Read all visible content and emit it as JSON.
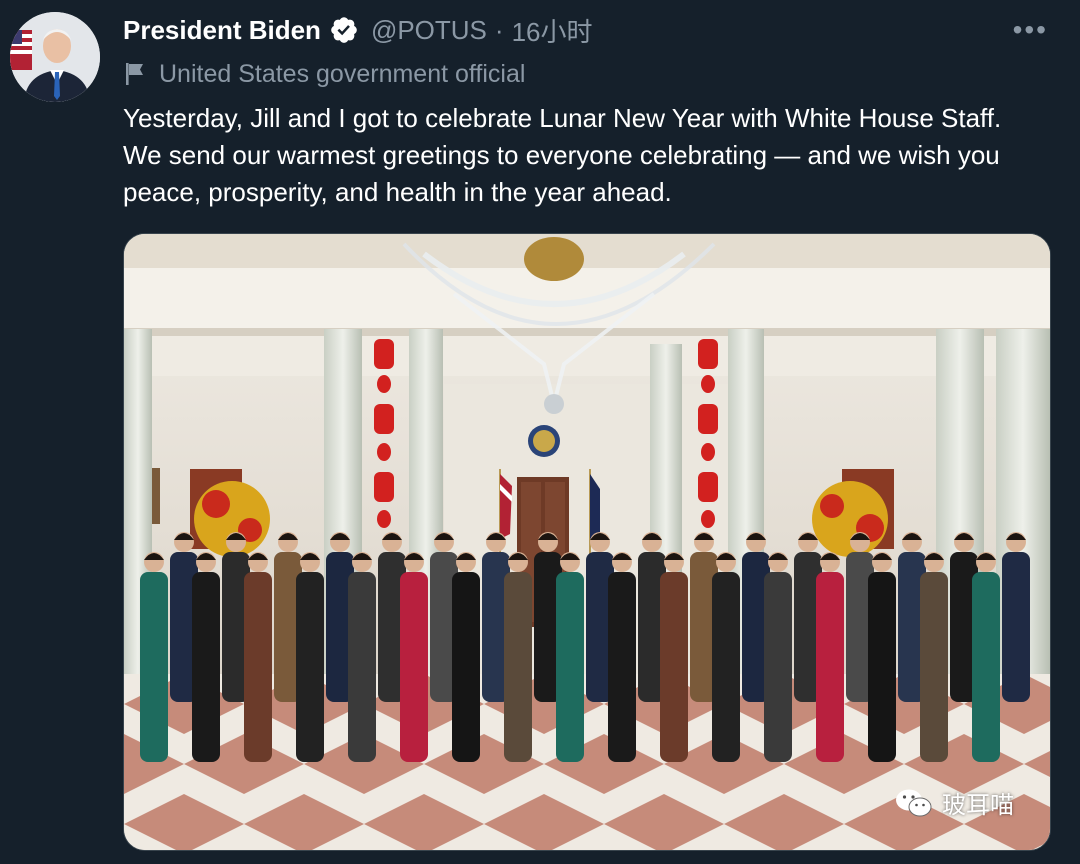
{
  "tweet": {
    "author_name": "President Biden",
    "handle": "@POTUS",
    "separator": "·",
    "time": "16小时",
    "account_label": "United States government official",
    "text": "Yesterday, Jill and I got to celebrate Lunar New Year with White House Staff. We send our warmest greetings to everyone celebrating — and we wish you peace, prosperity, and health in the year ahead.",
    "more_label": "•••"
  },
  "watermark": {
    "text": "玻耳喵"
  },
  "icons": {
    "verified": "verified-badge-icon",
    "label": "flag-icon",
    "more": "more-options-icon",
    "watermark": "wechat-icon"
  },
  "colors": {
    "background": "#15202b",
    "text_primary": "#ffffff",
    "text_secondary": "#8b98a5",
    "verified_badge": "#ffffff"
  }
}
